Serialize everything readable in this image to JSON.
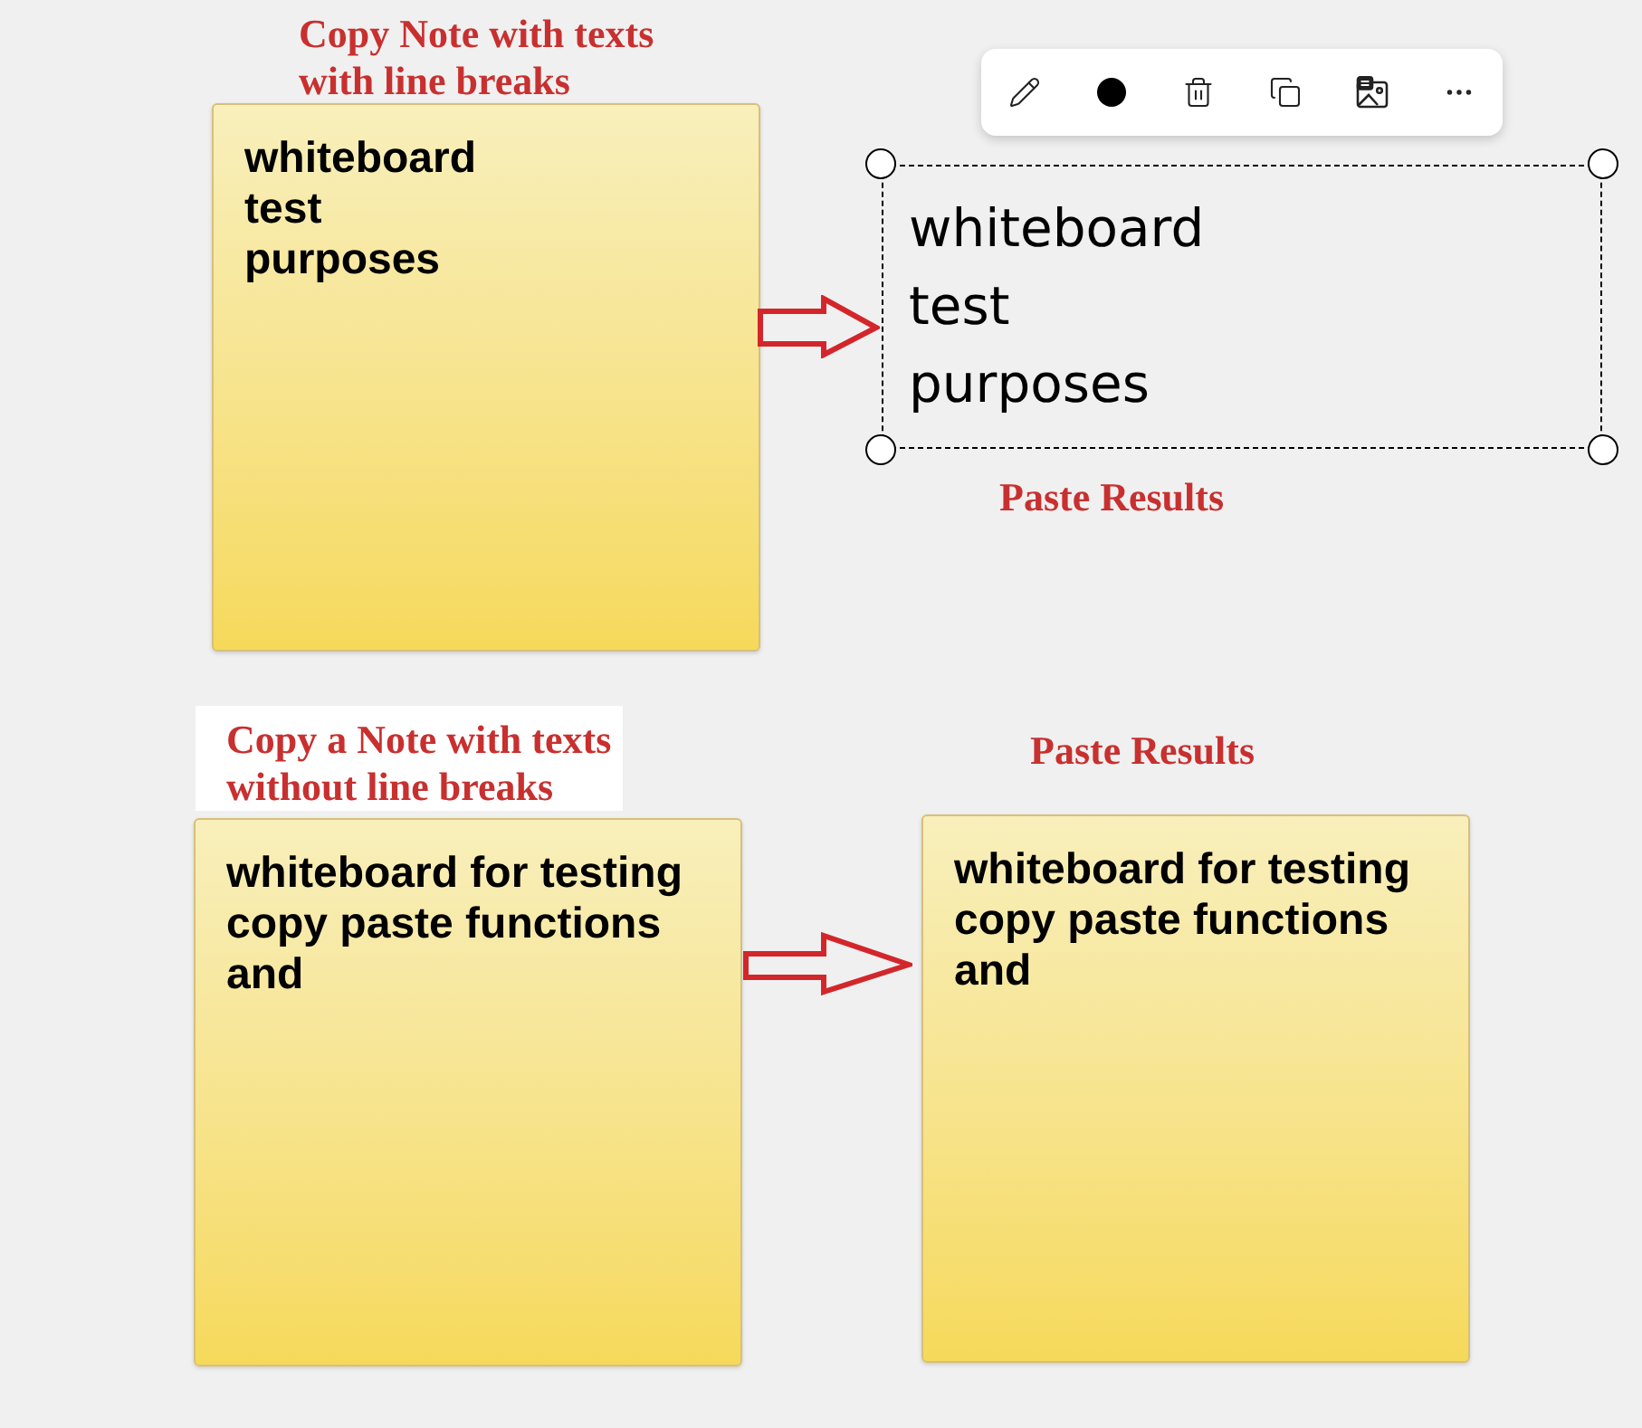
{
  "sections": [
    {
      "caption": {
        "lines": [
          "Copy Note with texts",
          "with line breaks"
        ],
        "highlighted": false
      },
      "source_note": {
        "lines": [
          "whiteboard",
          "test",
          "purposes"
        ]
      },
      "result_label": "Paste Results",
      "result": {
        "kind": "text",
        "selected": true,
        "lines": [
          "whiteboard",
          "test",
          "purposes"
        ]
      }
    },
    {
      "caption": {
        "lines": [
          "Copy a Note with texts",
          "without line breaks"
        ],
        "highlighted": true
      },
      "source_note": {
        "lines": [
          "whiteboard for testing copy paste functions and"
        ]
      },
      "result_label": "Paste Results",
      "result": {
        "kind": "note",
        "selected": false,
        "lines": [
          "whiteboard for testing copy paste functions and"
        ]
      }
    }
  ]
}
